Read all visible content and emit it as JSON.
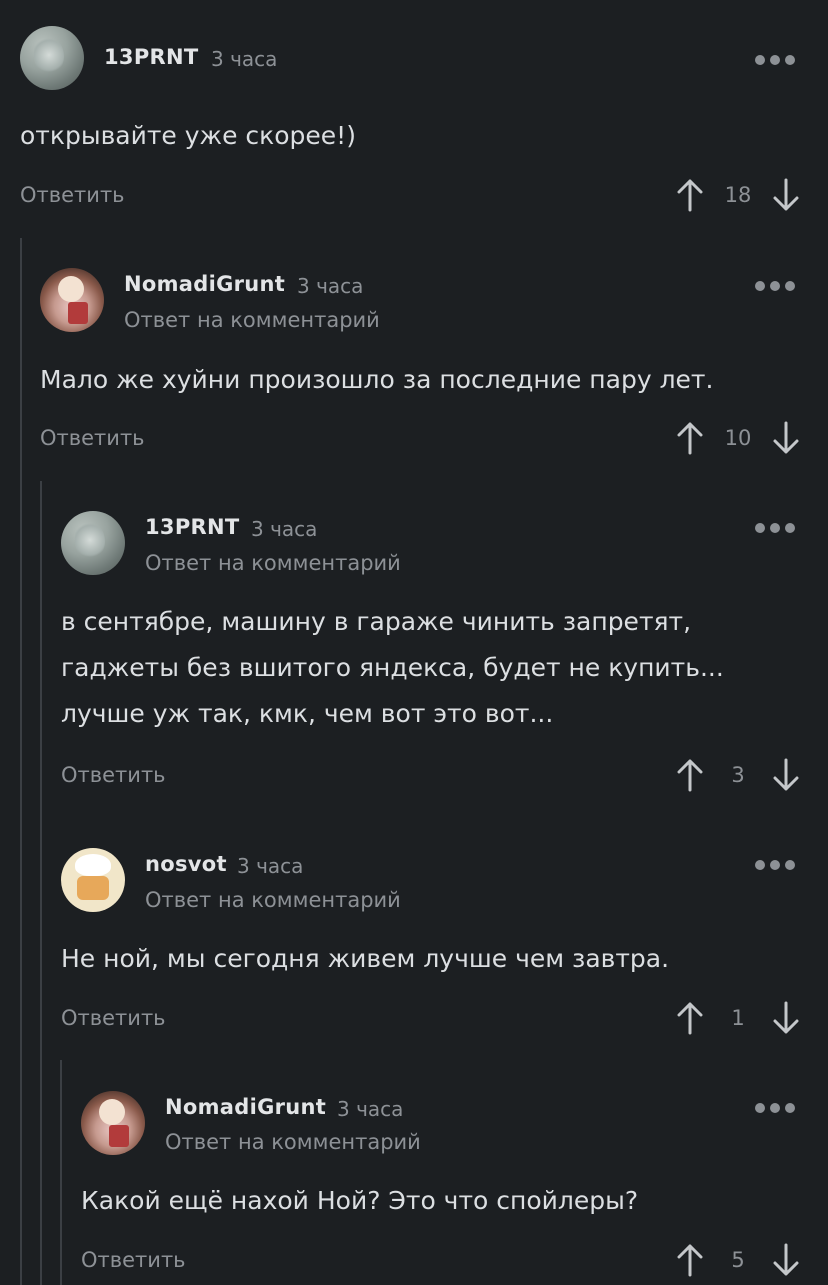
{
  "reply_label": "Ответить",
  "reply_to_label": "Ответ на комментарий",
  "comments": [
    {
      "author": "13PRNT",
      "time": "3 часа",
      "text": [
        "открывайте уже скорее!)"
      ],
      "rating": "18",
      "avatar_icon": "gray-blob-avatar"
    },
    {
      "author": "NomadiGrunt",
      "time": "3 часа",
      "text": [
        "Мало же хуйни произошло за последние пару лет."
      ],
      "rating": "10",
      "avatar_icon": "pony-avatar"
    },
    {
      "author": "13PRNT",
      "time": "3 часа",
      "text": [
        "в сентябре, машину в гараже чинить запретят,",
        "гаджеты без вшитого яндекса, будет не купить...",
        "лучше уж так, кмк, чем вот это вот..."
      ],
      "rating": "3",
      "avatar_icon": "gray-blob-avatar"
    },
    {
      "author": "nosvot",
      "time": "3 часа",
      "text": [
        "Не ной, мы сегодня живем лучше чем завтра."
      ],
      "rating": "1",
      "avatar_icon": "chef-avatar"
    },
    {
      "author": "NomadiGrunt",
      "time": "3 часа",
      "text": [
        "Какой ещё нахой Ной? Это что спойлеры?"
      ],
      "rating": "5",
      "avatar_icon": "pony-avatar"
    }
  ],
  "colors": {
    "background": "#1c1f22",
    "text": "#dcdfe2",
    "muted": "#8d9196",
    "thread_line": "#3b3f44"
  }
}
